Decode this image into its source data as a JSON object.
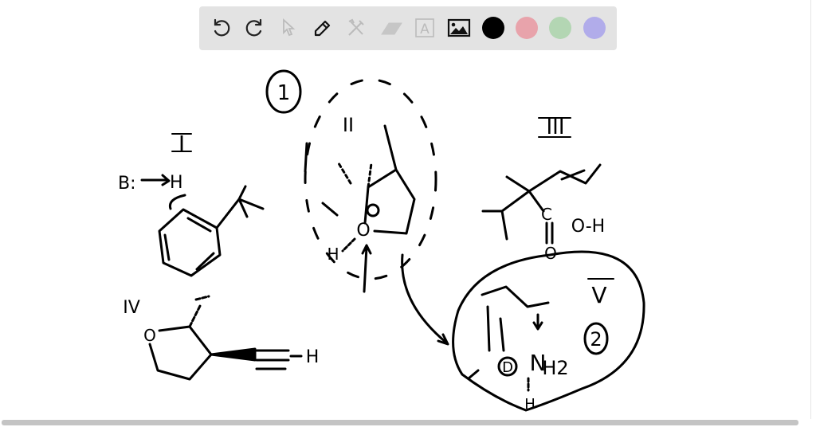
{
  "toolbar": {
    "tools": [
      {
        "name": "undo-icon",
        "enabled": true
      },
      {
        "name": "redo-icon",
        "enabled": true
      },
      {
        "name": "select-icon",
        "enabled": false
      },
      {
        "name": "pen-icon",
        "enabled": true
      },
      {
        "name": "tools-icon",
        "enabled": false
      },
      {
        "name": "eraser-icon",
        "enabled": false
      },
      {
        "name": "text-icon",
        "enabled": false,
        "glyph": "A"
      },
      {
        "name": "image-icon",
        "enabled": true
      }
    ],
    "colors": [
      "#000000",
      "#e8a3ab",
      "#b3d6b3",
      "#b1acea"
    ],
    "selected_color": "#000000"
  },
  "drawing": {
    "labels": {
      "step1": "1",
      "roman1": "I",
      "roman2": "II",
      "roman3": "III",
      "roman4": "IV",
      "roman5": "V",
      "step2": "2",
      "base": "B:",
      "h1": "H",
      "h2": "H",
      "o1": "O",
      "o2": "O",
      "c1": "C",
      "oh": "O-H",
      "o3": "O",
      "o4": "O",
      "h3": "H",
      "nh2": "H2",
      "n": "N",
      "d": "D",
      "h4": "H"
    }
  }
}
